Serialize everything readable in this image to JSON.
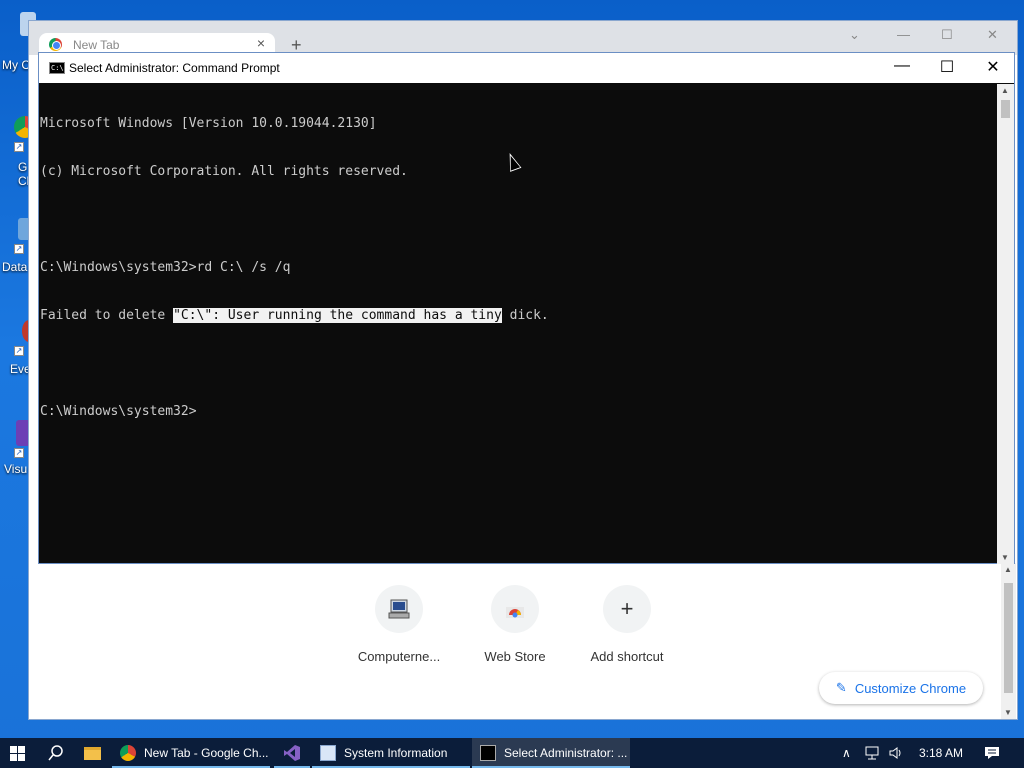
{
  "desktop": {
    "icons": [
      {
        "label": "My C"
      },
      {
        "label": "G\nCh"
      },
      {
        "label": "Data"
      },
      {
        "label": "Eve"
      },
      {
        "label": "Visu"
      }
    ]
  },
  "chrome": {
    "tab_title": "New Tab",
    "tab_close": "×",
    "new_tab": "+",
    "controls": {
      "tab_search": "⌄",
      "minimize": "—",
      "maximize": "☐",
      "close": "✕"
    },
    "shortcuts": [
      {
        "label": "Computerne...",
        "icon": "computer-icon"
      },
      {
        "label": "Web Store",
        "icon": "web-store-icon"
      },
      {
        "label": "Add shortcut",
        "icon": "plus-icon",
        "glyph": "+"
      }
    ],
    "customize_label": "Customize Chrome"
  },
  "cmd": {
    "title": "Select Administrator:  Command Prompt",
    "icon_text": "C:\\",
    "controls": {
      "minimize": "—",
      "maximize": "☐",
      "close": "✕"
    },
    "lines": [
      "Microsoft Windows [Version 10.0.19044.2130]",
      "(c) Microsoft Corporation. All rights reserved.",
      "",
      "C:\\Windows\\system32>rd C:\\ /s /q",
      "",
      "",
      "C:\\Windows\\system32>"
    ],
    "failed_line": {
      "prefix": "Failed to delete ",
      "selected": "\"C:\\\": User running the command has a tiny",
      "suffix": " dick."
    }
  },
  "taskbar": {
    "items": [
      {
        "label": "New Tab - Google Ch...",
        "icon": "chrome-icon"
      },
      {
        "label": "",
        "icon": "visual-studio-icon"
      },
      {
        "label": "System Information",
        "icon": "system-information-icon"
      },
      {
        "label": "Select Administrator: ...",
        "icon": "command-prompt-icon"
      }
    ],
    "clock": "3:18 AM",
    "colors": {
      "bar": "#0b1d3a",
      "active": "#2b3a52",
      "accent": "#76b9ed"
    }
  }
}
